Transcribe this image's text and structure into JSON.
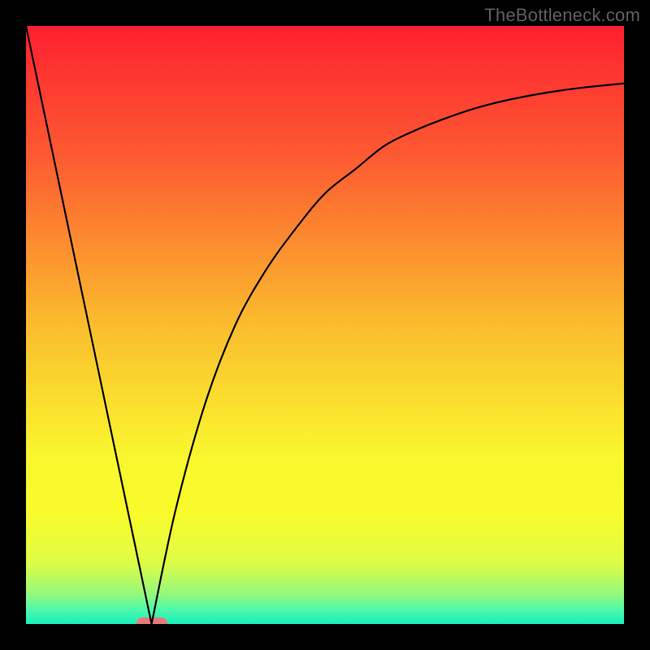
{
  "attribution": "TheBottleneck.com",
  "chart_data": {
    "type": "line",
    "title": "",
    "xlabel": "",
    "ylabel": "",
    "xlim": [
      0,
      100
    ],
    "ylim": [
      0,
      100
    ],
    "optimal_x": 21,
    "series": [
      {
        "name": "bottleneck-curve",
        "x": [
          0,
          5,
          10,
          15,
          20,
          21,
          25,
          30,
          35,
          40,
          45,
          50,
          55,
          60,
          65,
          70,
          75,
          80,
          85,
          90,
          95,
          100
        ],
        "values": [
          100,
          76,
          53,
          29,
          5,
          0,
          19,
          37,
          50,
          59,
          66,
          72,
          76,
          80,
          82.5,
          84.5,
          86.2,
          87.5,
          88.5,
          89.3,
          89.9,
          90.4
        ]
      }
    ],
    "background_gradient_stops": [
      {
        "offset": 0.0,
        "color": "#FE2030"
      },
      {
        "offset": 0.22,
        "color": "#FD5B31"
      },
      {
        "offset": 0.5,
        "color": "#FBBC2E"
      },
      {
        "offset": 0.72,
        "color": "#F9F72D"
      },
      {
        "offset": 0.82,
        "color": "#F8FB2C"
      },
      {
        "offset": 0.9,
        "color": "#DCFC47"
      },
      {
        "offset": 0.95,
        "color": "#94F97C"
      },
      {
        "offset": 0.975,
        "color": "#4FF9AA"
      },
      {
        "offset": 1.0,
        "color": "#18F0BB"
      }
    ],
    "optimal_marker_color": "#E77A79"
  }
}
